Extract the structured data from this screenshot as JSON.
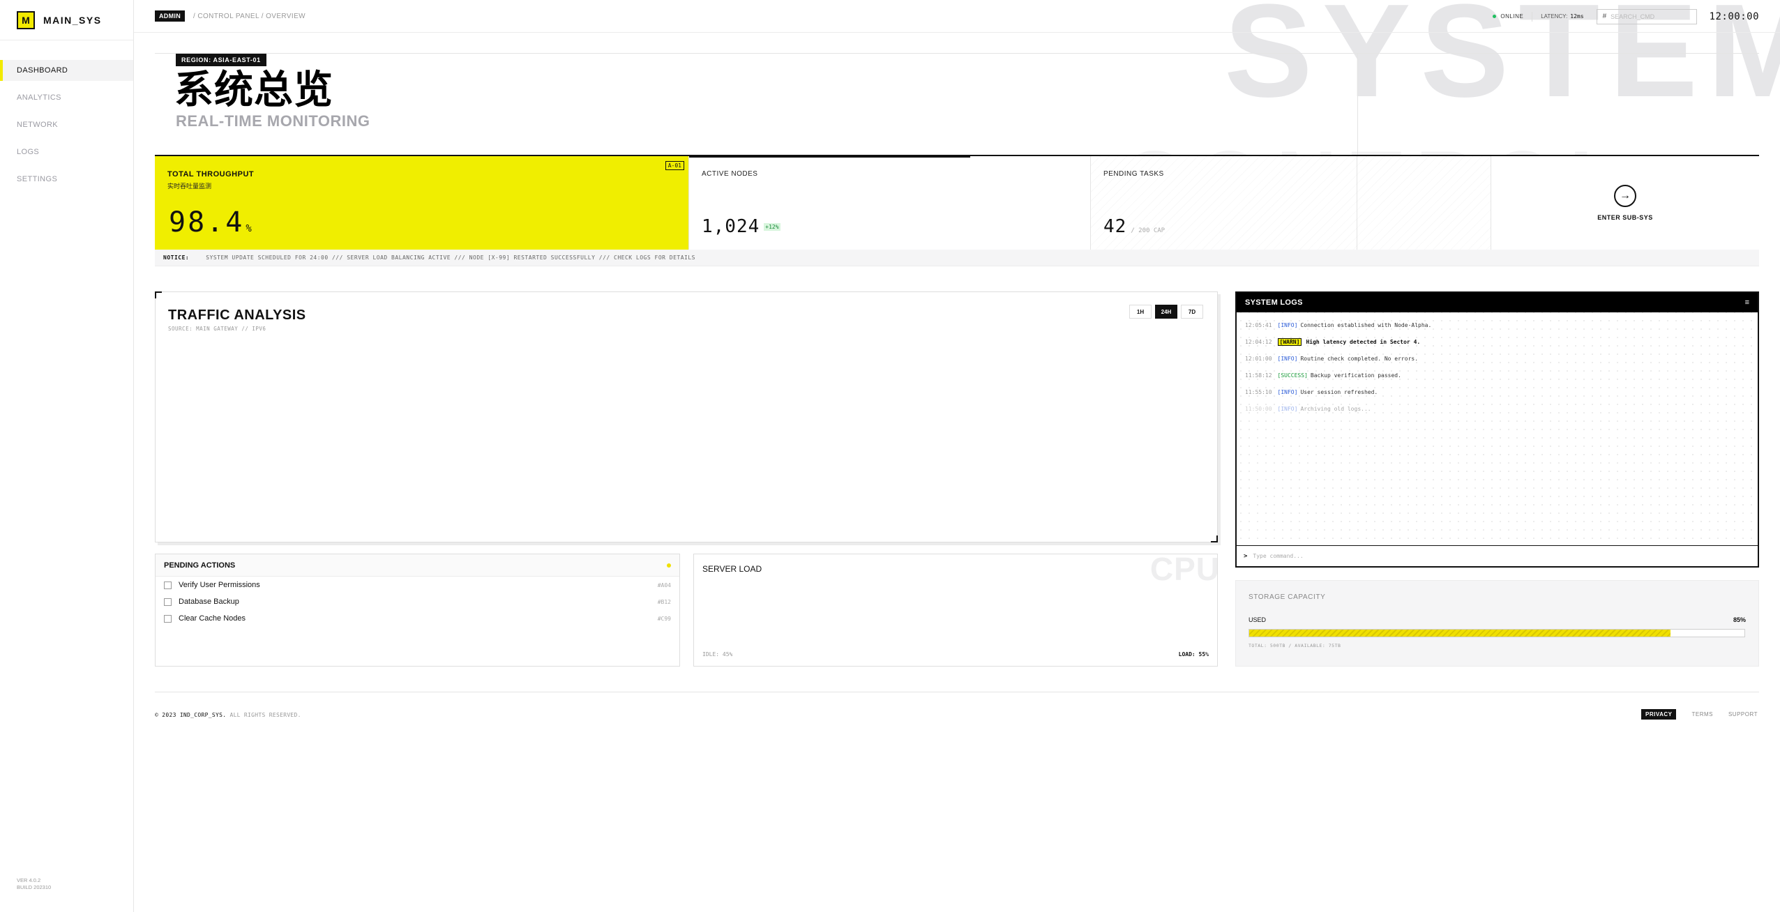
{
  "app": {
    "logo_letter": "M",
    "name": "MAIN_SYS",
    "version": "VER 4.0.2",
    "build": "BUILD 202310"
  },
  "sidebar": {
    "items": [
      {
        "label": "DASHBOARD",
        "active": true
      },
      {
        "label": "ANALYTICS",
        "active": false
      },
      {
        "label": "NETWORK",
        "active": false
      },
      {
        "label": "LOGS",
        "active": false
      },
      {
        "label": "SETTINGS",
        "active": false
      }
    ]
  },
  "topbar": {
    "role": "ADMIN",
    "breadcrumb": "/ CONTROL PANEL / OVERVIEW",
    "status": "ONLINE",
    "latency_label": "LATENCY:",
    "latency_value": "12ms",
    "search_hash": "#",
    "search_placeholder": "SEARCH_CMD",
    "clock": "12:00:00"
  },
  "background": {
    "watermark": "SYSTEM",
    "watermark2": "CONTROL"
  },
  "hero": {
    "region": "REGION: ASIA-EAST-01",
    "title": "系统总览",
    "subtitle": "REAL-TIME MONITORING"
  },
  "stats": {
    "throughput": {
      "label": "TOTAL THROUGHPUT",
      "sublabel": "实时吞吐量监测",
      "tag": "A-01",
      "value": "98.4",
      "unit": "%"
    },
    "nodes": {
      "label": "ACTIVE NODES",
      "value": "1,024",
      "delta": "+12%",
      "progress": 0.7
    },
    "tasks": {
      "label": "PENDING TASKS",
      "value": "42",
      "cap": "/ 200 CAP"
    },
    "enter": {
      "label": "ENTER SUB-SYS",
      "icon": "arrow-right-icon"
    }
  },
  "notice": {
    "label": "NOTICE:",
    "text": "SYSTEM UPDATE SCHEDULED FOR 24:00 /// SERVER LOAD BALANCING ACTIVE /// NODE [X-99] RESTARTED SUCCESSFULLY /// CHECK LOGS FOR DETAILS"
  },
  "traffic": {
    "title": "TRAFFIC ANALYSIS",
    "source": "SOURCE: MAIN GATEWAY // IPV6",
    "ranges": [
      "1H",
      "24H",
      "7D"
    ],
    "active_range": "24H"
  },
  "logs": {
    "title": "SYSTEM LOGS",
    "entries": [
      {
        "time": "12:05:41",
        "level": "[INFO]",
        "message": "Connection established with Node-Alpha."
      },
      {
        "time": "12:04:12",
        "level": "[WARN]",
        "message": "High latency detected in Sector 4."
      },
      {
        "time": "12:01:00",
        "level": "[INFO]",
        "message": "Routine check completed. No errors."
      },
      {
        "time": "11:58:12",
        "level": "[SUCCESS]",
        "message": "Backup verification passed."
      },
      {
        "time": "11:55:10",
        "level": "[INFO]",
        "message": "User session refreshed."
      },
      {
        "time": "11:50:00",
        "level": "[INFO]",
        "message": "Archiving old logs..."
      }
    ],
    "prompt": ">",
    "input_placeholder": "Type command..."
  },
  "pending": {
    "title": "PENDING ACTIONS",
    "tasks": [
      {
        "label": "Verify User Permissions",
        "id": "#A04"
      },
      {
        "label": "Database Backup",
        "id": "#B12"
      },
      {
        "label": "Clear Cache Nodes",
        "id": "#C99"
      }
    ]
  },
  "server": {
    "title": "SERVER LOAD",
    "watermark": "CPU",
    "idle": "IDLE: 45%",
    "load": "LOAD: 55%"
  },
  "storage": {
    "title": "STORAGE CAPACITY",
    "used_label": "USED",
    "used_pct": "85%",
    "fill": 0.85,
    "footer": "TOTAL: 500TB / AVAILABLE: 75TB"
  },
  "footer": {
    "copyright": "© 2023 IND_CORP_SYS.",
    "rights": "ALL RIGHTS RESERVED.",
    "links": [
      "PRIVACY",
      "TERMS",
      "SUPPORT"
    ]
  },
  "colors": {
    "accent": "#f0ee00",
    "dark": "#111111",
    "online": "#20c060"
  }
}
